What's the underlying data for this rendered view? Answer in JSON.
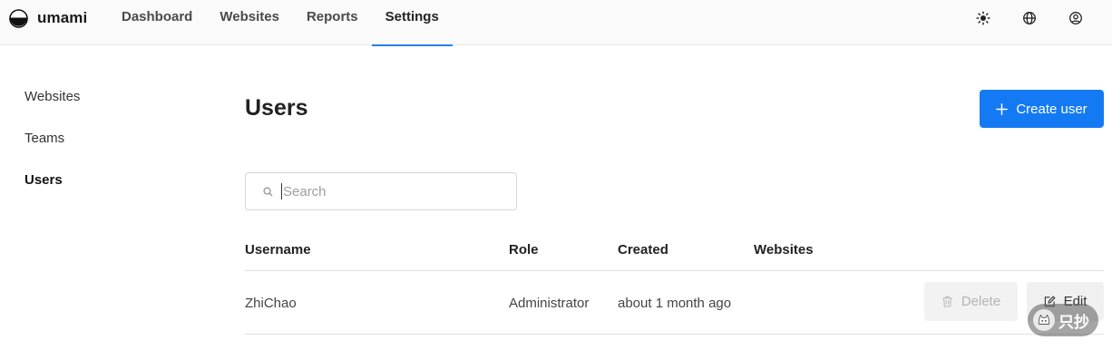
{
  "app": {
    "name": "umami"
  },
  "nav": [
    {
      "label": "Dashboard",
      "active": false
    },
    {
      "label": "Websites",
      "active": false
    },
    {
      "label": "Reports",
      "active": false
    },
    {
      "label": "Settings",
      "active": true
    }
  ],
  "header_actions": [
    {
      "icon": "sun-icon",
      "label": "Theme"
    },
    {
      "icon": "globe-icon",
      "label": "Language"
    },
    {
      "icon": "user-circle-icon",
      "label": "Profile"
    }
  ],
  "sidebar": {
    "items": [
      {
        "label": "Websites",
        "active": false
      },
      {
        "label": "Teams",
        "active": false
      },
      {
        "label": "Users",
        "active": true
      }
    ]
  },
  "page": {
    "title": "Users",
    "create_label": "Create user"
  },
  "search": {
    "placeholder": "Search",
    "value": ""
  },
  "table": {
    "columns": [
      "Username",
      "Role",
      "Created",
      "Websites"
    ],
    "rows": [
      {
        "username": "ZhiChao",
        "role": "Administrator",
        "created": "about 1 month ago",
        "websites": "",
        "delete_label": "Delete",
        "edit_label": "Edit"
      }
    ]
  },
  "watermark": {
    "text": "只抄"
  },
  "colors": {
    "accent": "#147af3",
    "nav_underline": "#2680eb",
    "header_bg": "#fafafa",
    "disabled_text": "#b4b4b4"
  }
}
